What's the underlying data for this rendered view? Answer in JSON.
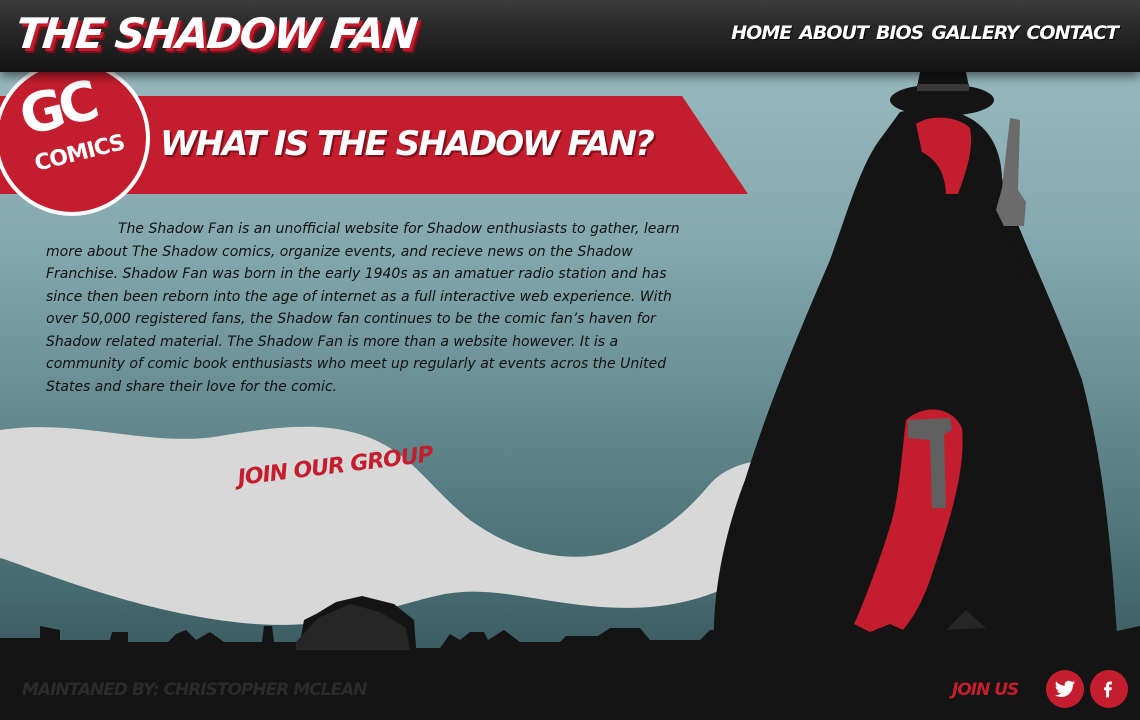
{
  "header": {
    "site_title": "THE SHADOW FAN",
    "nav": [
      "HOME",
      "ABOUT",
      "BIOS",
      "GALLERY",
      "CONTACT"
    ]
  },
  "logo": {
    "top_text": "GC",
    "bottom_text": "COMICS"
  },
  "banner": {
    "title": "WHAT IS THE SHADOW FAN?"
  },
  "intro": {
    "text": "The Shadow Fan is an unofficial website for Shadow enthusiasts to gather, learn more about The Shadow comics, organize events, and recieve news on the Shadow Franchise. Shadow Fan was born in the early 1940s as an amatuer radio station and has since then been reborn into the age of internet as a full interactive web experience. With over 50,000 registered fans, the Shadow fan continues to be the comic fan’s haven for Shadow related material. The Shadow Fan is more than a website however. It is a community of comic book enthusiasts who meet up regularly at events acros the United States and share their love for the comic."
  },
  "cta": {
    "join_group": "JOIN OUR GROUP"
  },
  "footer": {
    "maintained_by": "MAINTANED BY: CHRISTOPHER MCLEAN",
    "join_us": "JOIN US",
    "social": [
      {
        "name": "twitter",
        "icon": "twitter-bird-icon"
      },
      {
        "name": "facebook",
        "icon": "facebook-f-icon"
      }
    ]
  },
  "colors": {
    "accent_red": "#c41e2e",
    "header_dark": "#1b1b1b",
    "sky_top": "#9fc0c4",
    "sky_bottom": "#304d52",
    "smoke": "#d8d8d8",
    "silhouette": "#141414"
  }
}
